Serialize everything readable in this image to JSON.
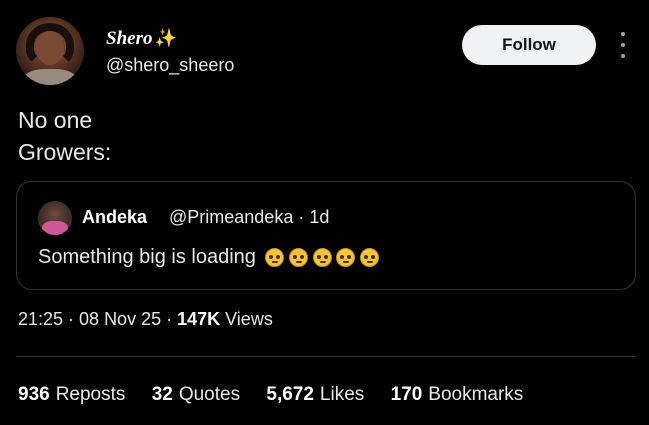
{
  "author": {
    "display_name": "Shero",
    "name_emoji": "✨",
    "handle": "@shero_sheero"
  },
  "header": {
    "follow_label": "Follow",
    "more_icon": "more-vertical-icon"
  },
  "tweet": {
    "lines": [
      "No one",
      "Growers:"
    ]
  },
  "quote": {
    "name": "Andeka",
    "handle_time": "@Primeandeka · 1d",
    "text": "Something big is loading",
    "emoji_count": 5,
    "emoji": "pleading-face"
  },
  "meta": {
    "time_date": "21:25 · 08 Nov 25 · ",
    "views_count": "147K",
    "views_label": " Views"
  },
  "stats": {
    "reposts_count": "936",
    "reposts_label": "Reposts",
    "quotes_count": "32",
    "quotes_label": "Quotes",
    "likes_count": "5,672",
    "likes_label": "Likes",
    "bookmarks_count": "170",
    "bookmarks_label": "Bookmarks"
  },
  "colors": {
    "background": "#000000",
    "text": "#e7e9ea",
    "border": "#2f3336",
    "follow_bg": "#eff3f4"
  }
}
